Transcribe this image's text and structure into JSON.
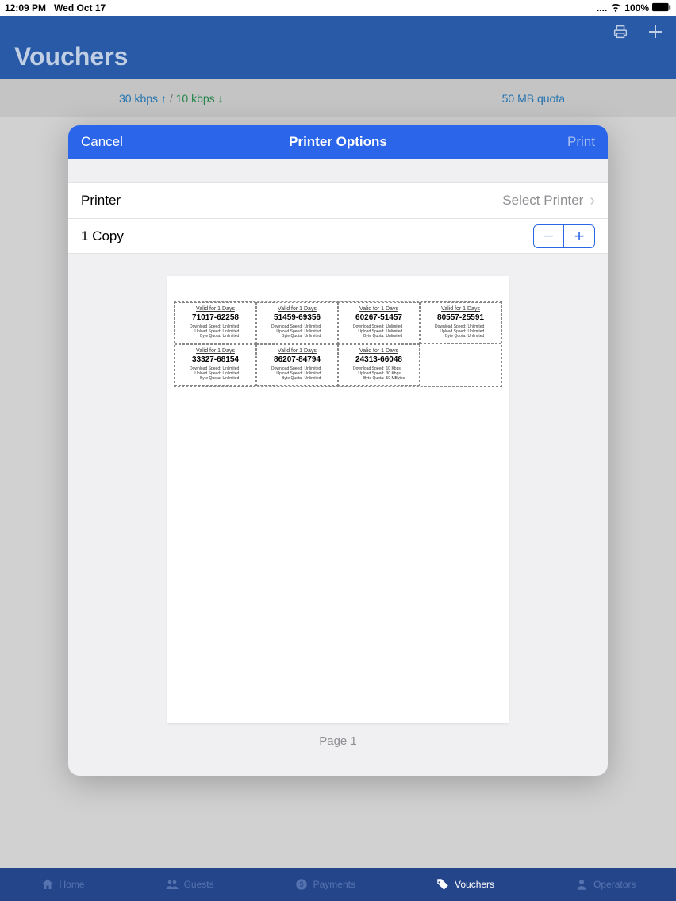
{
  "status": {
    "time": "12:09 PM",
    "date": "Wed Oct 17",
    "battery": "100%"
  },
  "header": {
    "title": "Vouchers"
  },
  "speedbar": {
    "down": "30 kbps ↑",
    "sep": "/",
    "up": "10 kbps ↓",
    "quota": "50 MB quota"
  },
  "modal": {
    "cancel": "Cancel",
    "title": "Printer Options",
    "print": "Print",
    "printer_label": "Printer",
    "printer_value": "Select Printer",
    "copies_label": "1 Copy"
  },
  "preview": {
    "page_label": "Page 1",
    "vouchers": [
      {
        "valid": "Valid for 1 Days",
        "code": "71017-62258",
        "dl": "Unlimited",
        "ul": "Unlimited",
        "bq": "Unlimited"
      },
      {
        "valid": "Valid for 1 Days",
        "code": "51459-69356",
        "dl": "Unlimited",
        "ul": "Unlimited",
        "bq": "Unlimited"
      },
      {
        "valid": "Valid for 1 Days",
        "code": "60267-51457",
        "dl": "Unlimited",
        "ul": "Unlimited",
        "bq": "Unlimited"
      },
      {
        "valid": "Valid for 1 Days",
        "code": "80557-25591",
        "dl": "Unlimited",
        "ul": "Unlimited",
        "bq": "Unlimited"
      },
      {
        "valid": "Valid for 1 Days",
        "code": "33327-68154",
        "dl": "Unlimited",
        "ul": "Unlimited",
        "bq": "Unlimited"
      },
      {
        "valid": "Valid for 1 Days",
        "code": "86207-84794",
        "dl": "Unlimited",
        "ul": "Unlimited",
        "bq": "Unlimited"
      },
      {
        "valid": "Valid for 1 Days",
        "code": "24313-66048",
        "dl": "10 Kbps",
        "ul": "30 Kbps",
        "bq": "50 MBytes"
      }
    ],
    "labels": {
      "dl": "Download Speed:",
      "ul": "Upload Speed:",
      "bq": "Byte Quota:"
    }
  },
  "tabs": {
    "home": "Home",
    "guests": "Guests",
    "payments": "Payments",
    "vouchers": "Vouchers",
    "operators": "Operators"
  }
}
